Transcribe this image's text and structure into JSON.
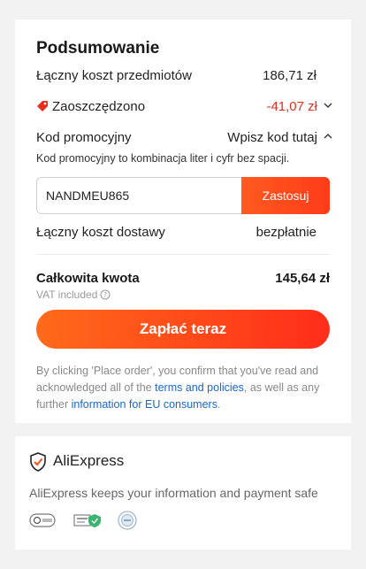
{
  "summary": {
    "title": "Podsumowanie",
    "items_label": "Łączny koszt przedmiotów",
    "items_value": "186,71 zł",
    "saved_label": "Zaoszczędzono",
    "saved_value": "-41,07 zł",
    "promo_label": "Kod promocyjny",
    "promo_toggle": "Wpisz kod tutaj",
    "promo_hint": "Kod promocyjny to kombinacja liter i cyfr bez spacji.",
    "promo_value": "NANDMEU865",
    "promo_apply": "Zastosuj",
    "shipping_label": "Łączny koszt dostawy",
    "shipping_value": "bezpłatnie",
    "total_label": "Całkowita kwota",
    "total_value": "145,64 zł",
    "vat_note": "VAT included",
    "pay_button": "Zapłać teraz",
    "legal_prefix": "By clicking 'Place order', you confirm that you've read and acknowledged all of the ",
    "legal_link1": "terms and policies",
    "legal_middle": ", as well as any further ",
    "legal_link2": "information for EU consumers",
    "legal_suffix": "."
  },
  "trust": {
    "brand": "AliExpress",
    "message": "AliExpress keeps your information and payment safe"
  },
  "colors": {
    "accent": "#ff4a1a",
    "discount": "#e62e1e",
    "link": "#1a66c9"
  }
}
